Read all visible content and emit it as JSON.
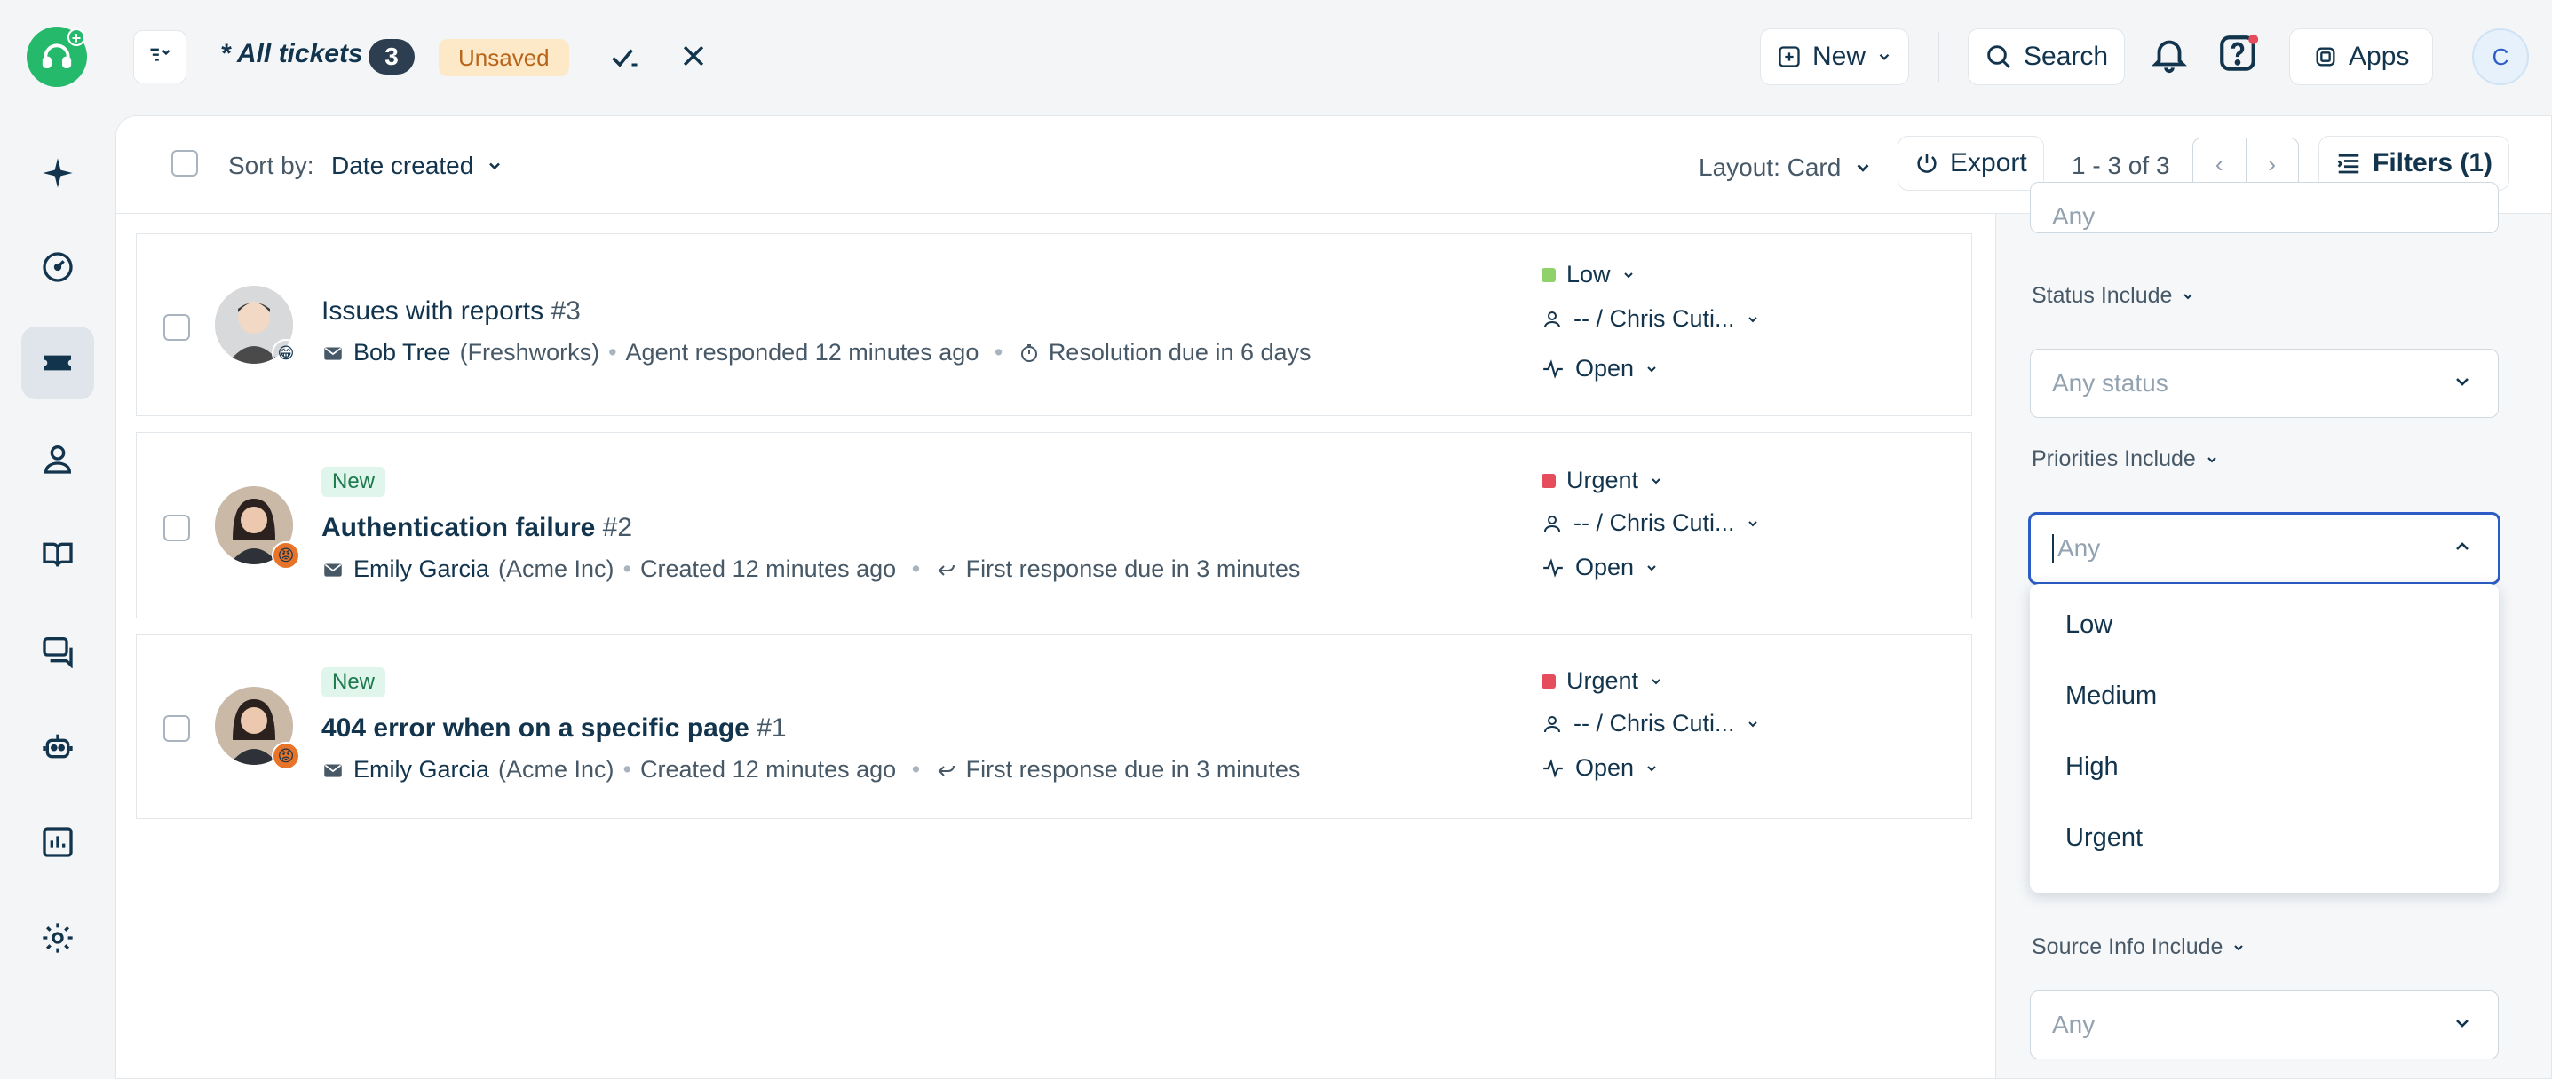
{
  "topbar": {
    "title": "* All tickets",
    "count": "3",
    "unsaved": "Unsaved",
    "new_label": "New",
    "search_label": "Search",
    "apps_label": "Apps",
    "avatar_initial": "C"
  },
  "toolbar": {
    "sort_label": "Sort by:",
    "sort_value": "Date created",
    "layout_label": "Layout: Card",
    "export_label": "Export",
    "pager_text": "1 - 3 of 3",
    "filters_label": "Filters (1)"
  },
  "tickets": [
    {
      "is_new": false,
      "subject": "Issues with reports",
      "number": "#3",
      "requester": "Bob Tree",
      "company": "(Freshworks)",
      "activity": "Agent responded 12 minutes ago",
      "sla": "Resolution due in 6 days",
      "priority": "Low",
      "priority_color": "#8fd16a",
      "assignee": "-- / Chris Cuti...",
      "status": "Open",
      "emoji": "😁",
      "emoji_color": "#f5c542"
    },
    {
      "is_new": true,
      "new_label": "New",
      "subject": "Authentication failure",
      "number": "#2",
      "requester": "Emily Garcia",
      "company": "(Acme Inc)",
      "activity": "Created 12 minutes ago",
      "sla": "First response due in 3 minutes",
      "priority": "Urgent",
      "priority_color": "#e54d5c",
      "assignee": "-- / Chris Cuti...",
      "status": "Open",
      "emoji": "😡",
      "emoji_color": "#e8742a"
    },
    {
      "is_new": true,
      "new_label": "New",
      "subject": "404 error when on a specific page",
      "number": "#1",
      "requester": "Emily Garcia",
      "company": "(Acme Inc)",
      "activity": "Created 12 minutes ago",
      "sla": "First response due in 3 minutes",
      "priority": "Urgent",
      "priority_color": "#e54d5c",
      "assignee": "-- / Chris Cuti...",
      "status": "Open",
      "emoji": "😡",
      "emoji_color": "#e8742a"
    }
  ],
  "filters": {
    "top_partial_value": "Any",
    "status_label": "Status Include",
    "status_placeholder": "Any status",
    "priorities_label": "Priorities Include",
    "priorities_placeholder": "Any",
    "source_label": "Source Info Include",
    "source_placeholder": "Any"
  },
  "priority_options": [
    "Low",
    "Medium",
    "High",
    "Urgent"
  ],
  "colors": {
    "brand": "#25b96c",
    "accent": "#2c5cc5",
    "text": "#12344d"
  }
}
